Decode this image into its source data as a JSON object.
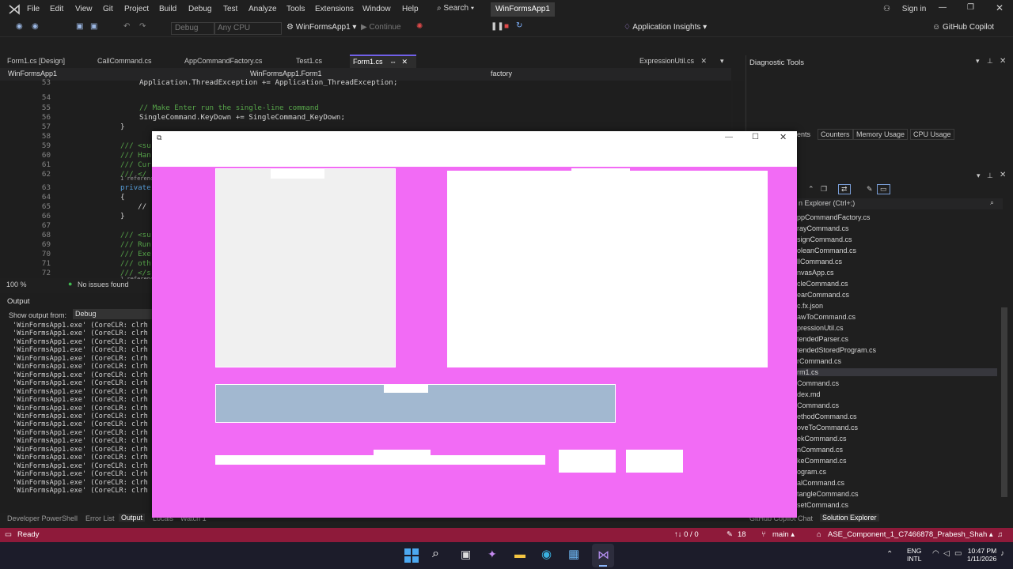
{
  "menu": [
    "File",
    "Edit",
    "View",
    "Git",
    "Project",
    "Build",
    "Debug",
    "Test",
    "Analyze",
    "Tools",
    "Extensions",
    "Window",
    "Help"
  ],
  "search_label": "Search",
  "app_title": "WinFormsApp1",
  "sign_in": "Sign in",
  "toolbar": {
    "config": "Debug",
    "platform": "Any CPU",
    "start_target": "WinFormsApp1",
    "continue": "Continue",
    "app_insights": "Application Insights",
    "copilot": "GitHub Copilot"
  },
  "tabs": [
    "Form1.cs [Design]",
    "CallCommand.cs",
    "AppCommandFactory.cs",
    "Test1.cs",
    "Form1.cs",
    "ExpressionUtil.cs"
  ],
  "navbar": {
    "project": "WinFormsApp1",
    "class": "WinFormsApp1.Form1",
    "member": "factory"
  },
  "code_lines": [
    {
      "n": "53",
      "t": "Application.ThreadException += Application_ThreadException;"
    },
    {
      "n": "54",
      "t": ""
    },
    {
      "n": "55",
      "t": "// Make Enter run the single-line command"
    },
    {
      "n": "56",
      "t": "SingleCommand.KeyDown += SingleCommand_KeyDown;"
    },
    {
      "n": "57",
      "t": "}"
    },
    {
      "n": "58",
      "t": ""
    },
    {
      "n": "59",
      "t": "/// <su"
    },
    {
      "n": "60",
      "t": "/// Han"
    },
    {
      "n": "61",
      "t": "/// Cur"
    },
    {
      "n": "62",
      "t": "/// </"
    },
    {
      "n": "63",
      "t": "private"
    },
    {
      "n": "64",
      "t": "{"
    },
    {
      "n": "65",
      "t": "    //"
    },
    {
      "n": "66",
      "t": "}"
    },
    {
      "n": "67",
      "t": ""
    },
    {
      "n": "68",
      "t": "/// <su"
    },
    {
      "n": "69",
      "t": "/// Run"
    },
    {
      "n": "70",
      "t": "/// Exe"
    },
    {
      "n": "71",
      "t": "/// oth"
    },
    {
      "n": "72",
      "t": "/// </s"
    }
  ],
  "ref_hint": "1 referenc",
  "zoom": "100 %",
  "issues": "No issues found",
  "output": {
    "title": "Output",
    "show_from": "Show output from:",
    "source": "Debug",
    "line": "'WinFormsApp1.exe' (CoreCLR: clrh",
    "line_count": 21
  },
  "bottom_tabs": [
    "Developer PowerShell",
    "Error List",
    "Output",
    "Locals",
    "Watch 1"
  ],
  "right_bottom_tabs": [
    "GitHub Copilot Chat",
    "Solution Explorer"
  ],
  "diagnostic": {
    "title": "Diagnostic Tools",
    "tabs": [
      "ents",
      "Counters",
      "Memory Usage",
      "CPU Usage"
    ]
  },
  "solution_explorer": {
    "search": "n Explorer (Ctrl+;)",
    "items": [
      "ppCommandFactory.cs",
      "rayCommand.cs",
      "signCommand.cs",
      "oleanCommand.cs",
      "llCommand.cs",
      "nvasApp.cs",
      "cleCommand.cs",
      "earCommand.cs",
      "c.fx.json",
      "awToCommand.cs",
      "pressionUtil.cs",
      "tendedParser.cs",
      "tendedStoredProgram.cs",
      "rCommand.cs",
      "rm1.cs",
      "Command.cs",
      "dex.md",
      "Command.cs",
      "ethodCommand.cs",
      "oveToCommand.cs",
      "ekCommand.cs",
      "nCommand.cs",
      "keCommand.cs",
      "ogram.cs",
      "alCommand.cs",
      "tangleCommand.cs",
      "setCommand.cs"
    ],
    "selected_index": 14
  },
  "statusbar": {
    "ready": "Ready",
    "updown": "↑↓ 0 / 0",
    "pencil": "18",
    "branch": "main",
    "repo": "ASE_Component_1_C7466878_Prabesh_Shah"
  },
  "taskbar": {
    "lang1": "ENG",
    "lang2": "INTL",
    "time": "10:47 PM",
    "date": "1/11/2026"
  },
  "colors": {
    "accent": "#7160e8",
    "status": "#8e1a3a",
    "form_bg": "#f26bf5",
    "button_panel": "#a2b8d0"
  }
}
